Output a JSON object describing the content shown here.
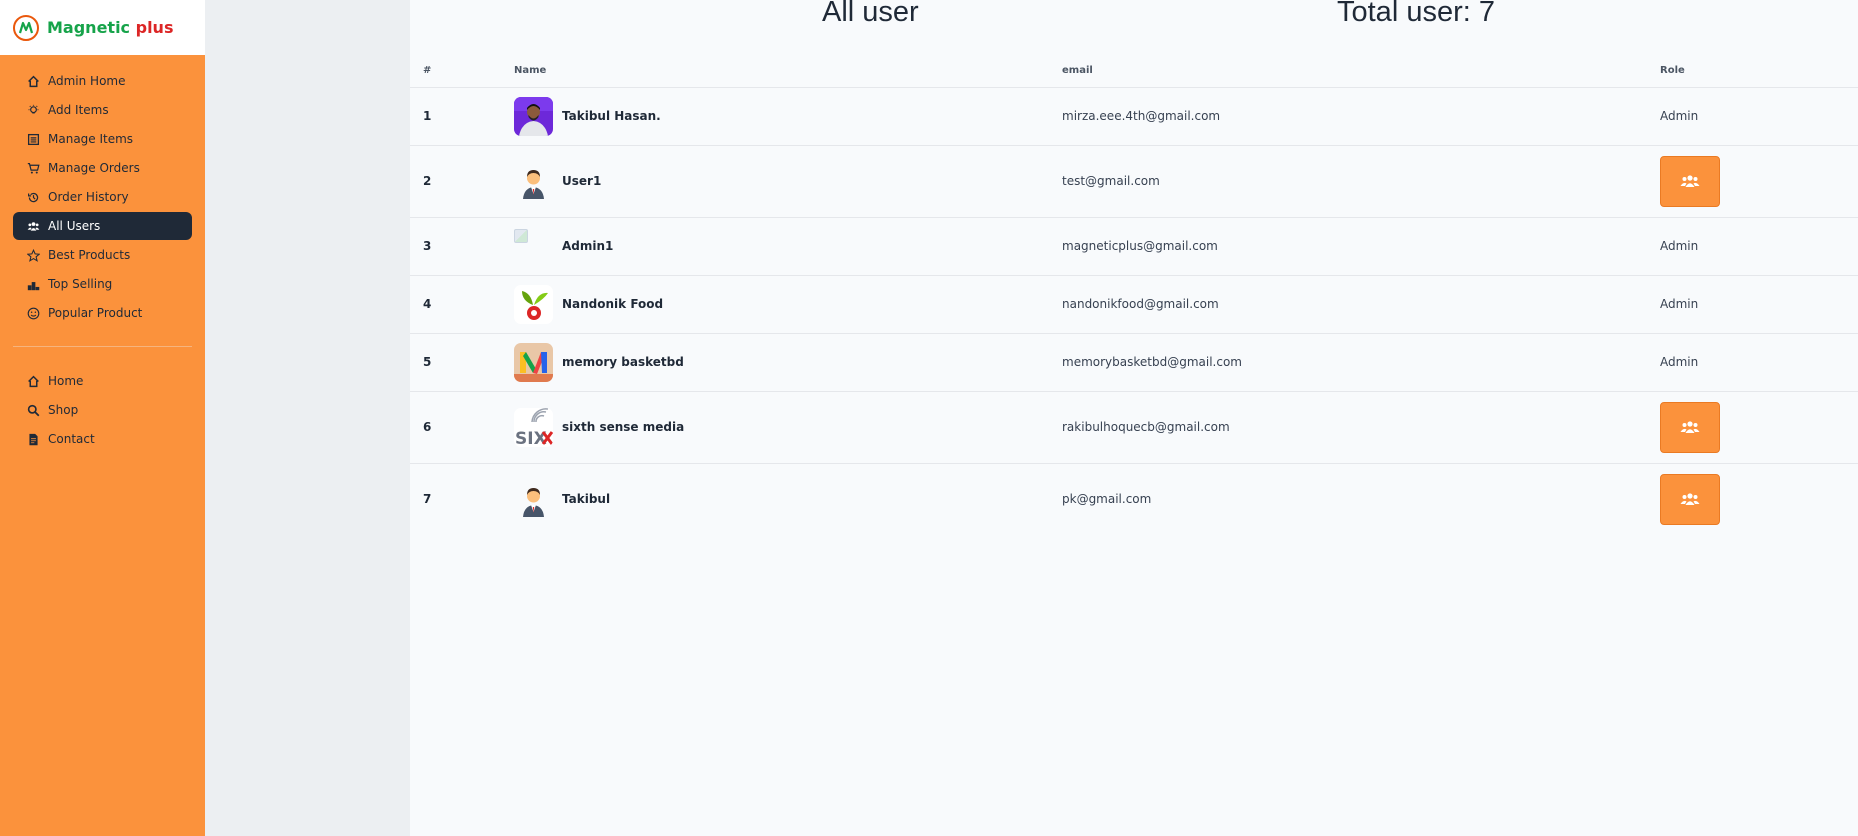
{
  "brand": {
    "name_part1": "Magnetic",
    "name_part2": "plus",
    "logo_icon": "magnetic-logo-icon",
    "colors": {
      "green": "#16a34a",
      "red": "#dc2626"
    }
  },
  "sidebar": {
    "admin_items": [
      {
        "label": "Admin Home",
        "icon": "home-icon"
      },
      {
        "label": "Add Items",
        "icon": "lightbulb-icon"
      },
      {
        "label": "Manage Items",
        "icon": "list-icon"
      },
      {
        "label": "Manage Orders",
        "icon": "cart-icon"
      },
      {
        "label": "Order History",
        "icon": "history-icon"
      },
      {
        "label": "All Users",
        "icon": "users-icon",
        "active": true
      },
      {
        "label": "Best Products",
        "icon": "star-icon"
      },
      {
        "label": "Top Selling",
        "icon": "podium-icon"
      },
      {
        "label": "Popular Product",
        "icon": "smile-icon"
      }
    ],
    "site_items": [
      {
        "label": "Home",
        "icon": "home-icon"
      },
      {
        "label": "Shop",
        "icon": "search-icon"
      },
      {
        "label": "Contact",
        "icon": "document-icon"
      }
    ],
    "bg_color": "#fb923c",
    "active_color": "#1f2937"
  },
  "main": {
    "title": "All user",
    "total_users": "Total user: 7",
    "columns": [
      "#",
      "Name",
      "email",
      "Role"
    ],
    "rows": [
      {
        "num": "1",
        "name": "Takibul Hasan.",
        "email": "mirza.eee.4th@gmail.com",
        "role": "Admin",
        "avatar": "photo-man-purple"
      },
      {
        "num": "2",
        "name": "User1",
        "email": "test@gmail.com",
        "role": "",
        "avatar": "businessman-avatar"
      },
      {
        "num": "3",
        "name": "Admin1",
        "email": "magneticplus@gmail.com",
        "role": "Admin",
        "avatar": "broken-image"
      },
      {
        "num": "4",
        "name": "Nandonik Food",
        "email": "nandonikfood@gmail.com",
        "role": "Admin",
        "avatar": "leaf-logo"
      },
      {
        "num": "5",
        "name": "memory basketbd",
        "email": "memorybasketbd@gmail.com",
        "role": "Admin",
        "avatar": "m-logo"
      },
      {
        "num": "6",
        "name": "sixth sense media",
        "email": "rakibulhoquecb@gmail.com",
        "role": "",
        "avatar": "six-logo"
      },
      {
        "num": "7",
        "name": "Takibul",
        "email": "pk@gmail.com",
        "role": "",
        "avatar": "businessman-avatar"
      }
    ],
    "accent_color": "#fb923c"
  }
}
